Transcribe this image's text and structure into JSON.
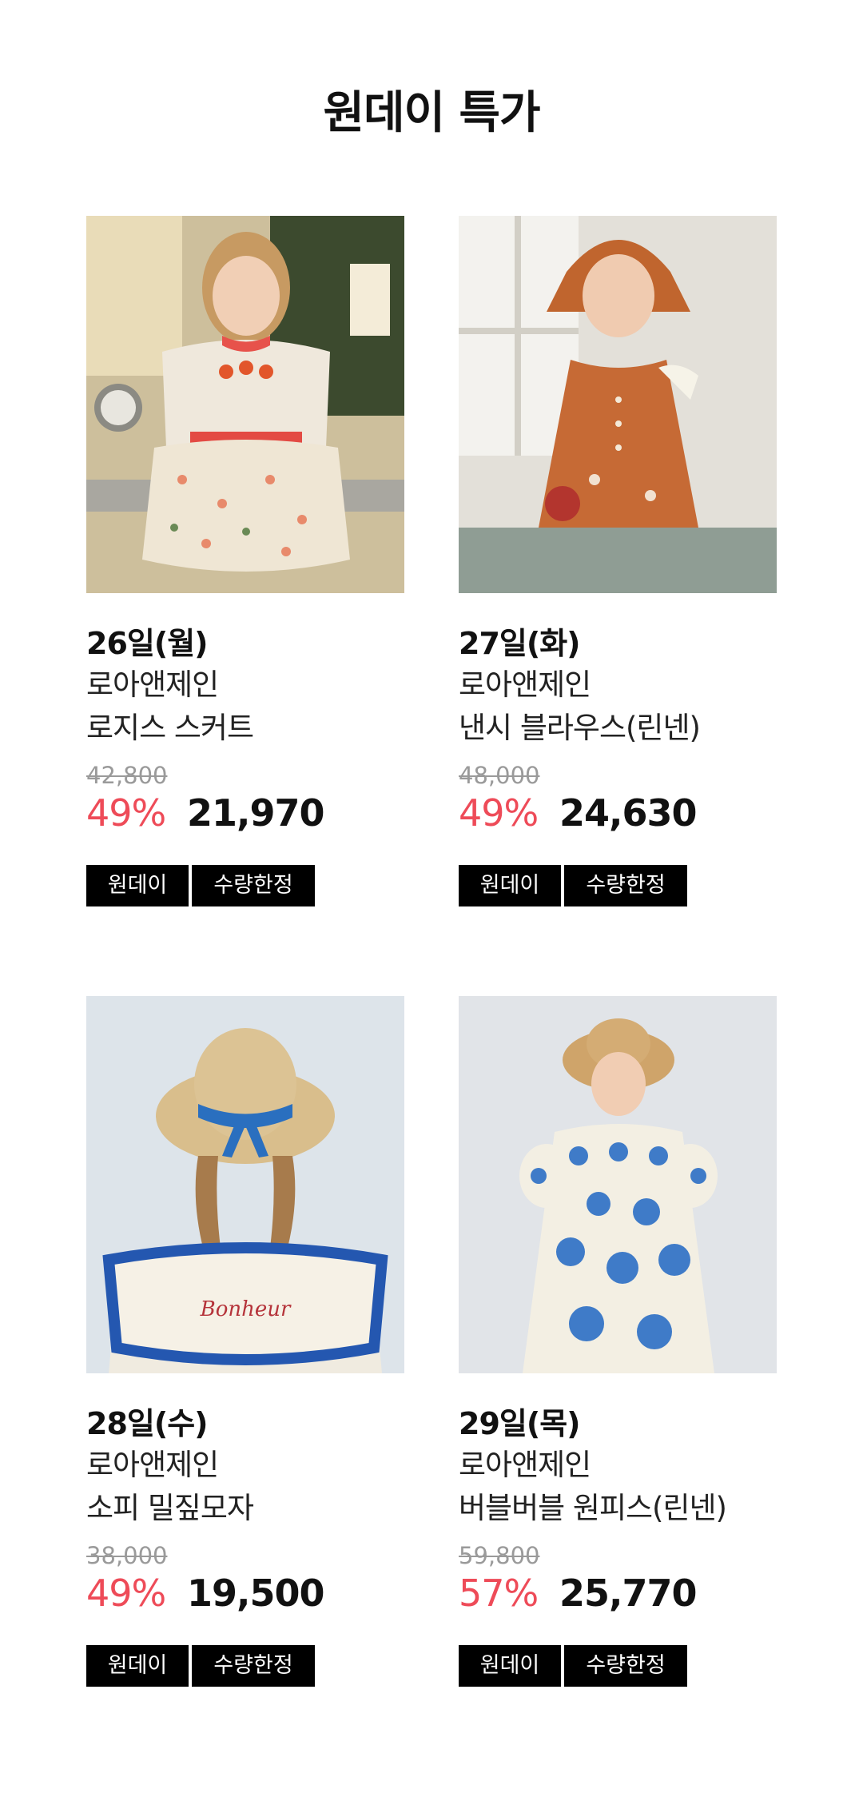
{
  "page_title": "원데이 특가",
  "products": [
    {
      "date": "26일(월)",
      "brand": "로아앤제인",
      "name": "로지스 스커트",
      "original_price": "42,800",
      "discount": "49%",
      "price": "21,970",
      "tags": [
        "원데이",
        "수량한정"
      ]
    },
    {
      "date": "27일(화)",
      "brand": "로아앤제인",
      "name": "낸시 블라우스(린넨)",
      "original_price": "48,000",
      "discount": "49%",
      "price": "24,630",
      "tags": [
        "원데이",
        "수량한정"
      ]
    },
    {
      "date": "28일(수)",
      "brand": "로아앤제인",
      "name": "소피 밀짚모자",
      "original_price": "38,000",
      "discount": "49%",
      "price": "19,500",
      "tags": [
        "원데이",
        "수량한정"
      ]
    },
    {
      "date": "29일(목)",
      "brand": "로아앤제인",
      "name": "버블버블 원피스(린넨)",
      "original_price": "59,800",
      "discount": "57%",
      "price": "25,770",
      "tags": [
        "원데이",
        "수량한정"
      ]
    }
  ],
  "colors": {
    "discount": "#ee4b58",
    "tag_background": "#000000",
    "tag_text": "#ffffff",
    "original_price": "#9a9a9a"
  }
}
